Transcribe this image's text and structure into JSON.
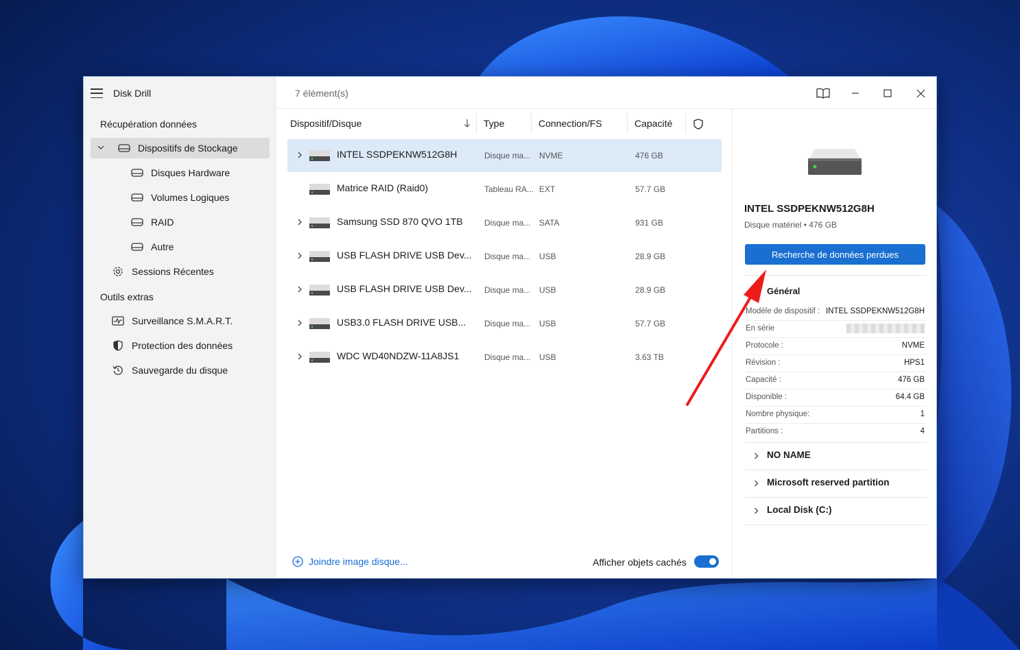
{
  "colors": {
    "accent": "#1a6fd1",
    "selection": "#dceaf8",
    "arrow": "#ee1b1b"
  },
  "window": {
    "app_title": "Disk Drill",
    "count": "7 élément(s)"
  },
  "sidebar": {
    "section1": "Récupération données",
    "storage": "Dispositifs de Stockage",
    "sub": [
      "Disques Hardware",
      "Volumes Logiques",
      "RAID",
      "Autre"
    ],
    "recent": "Sessions Récentes",
    "section2": "Outils extras",
    "tools": [
      "Surveillance S.M.A.R.T.",
      "Protection des données",
      "Sauvegarde du disque"
    ]
  },
  "table": {
    "headers": {
      "device": "Dispositif/Disque",
      "type": "Type",
      "conn": "Connection/FS",
      "cap": "Capacité"
    },
    "rows": [
      {
        "name": "INTEL SSDPEKNW512G8H",
        "type": "Disque ma...",
        "conn": "NVME",
        "cap": "476 GB"
      },
      {
        "name": "Matrice RAID (Raid0)",
        "type": "Tableau RA...",
        "conn": "EXT",
        "cap": "57.7 GB"
      },
      {
        "name": "Samsung SSD 870 QVO 1TB",
        "type": "Disque ma...",
        "conn": "SATA",
        "cap": "931 GB"
      },
      {
        "name": "USB FLASH DRIVE USB Dev...",
        "type": "Disque ma...",
        "conn": "USB",
        "cap": "28.9 GB"
      },
      {
        "name": "USB FLASH DRIVE USB Dev...",
        "type": "Disque ma...",
        "conn": "USB",
        "cap": "28.9 GB"
      },
      {
        "name": "USB3.0 FLASH DRIVE USB...",
        "type": "Disque ma...",
        "conn": "USB",
        "cap": "57.7 GB"
      },
      {
        "name": "WDC WD40NDZW-11A8JS1",
        "type": "Disque ma...",
        "conn": "USB",
        "cap": "3.63 TB"
      }
    ]
  },
  "footer": {
    "attach": "Joindre image disque...",
    "show_hidden": "Afficher objets cachés"
  },
  "detail": {
    "title": "INTEL SSDPEKNW512G8H",
    "subtitle": "Disque matériel • 476 GB",
    "button": "Recherche de données perdues",
    "general": "Général",
    "props": [
      {
        "k": "Modèle de dispositif :",
        "v": "INTEL SSDPEKNW512G8H"
      },
      {
        "k": "En série",
        "v": ""
      },
      {
        "k": "Protocole :",
        "v": "NVME"
      },
      {
        "k": "Révision :",
        "v": "HPS1"
      },
      {
        "k": "Capacité :",
        "v": "476 GB"
      },
      {
        "k": "Disponible :",
        "v": "64.4 GB"
      },
      {
        "k": "Nombre physique:",
        "v": "1"
      },
      {
        "k": "Partitions :",
        "v": "4"
      }
    ],
    "partitions": [
      "NO NAME",
      "Microsoft reserved partition",
      "Local Disk (C:)"
    ]
  }
}
